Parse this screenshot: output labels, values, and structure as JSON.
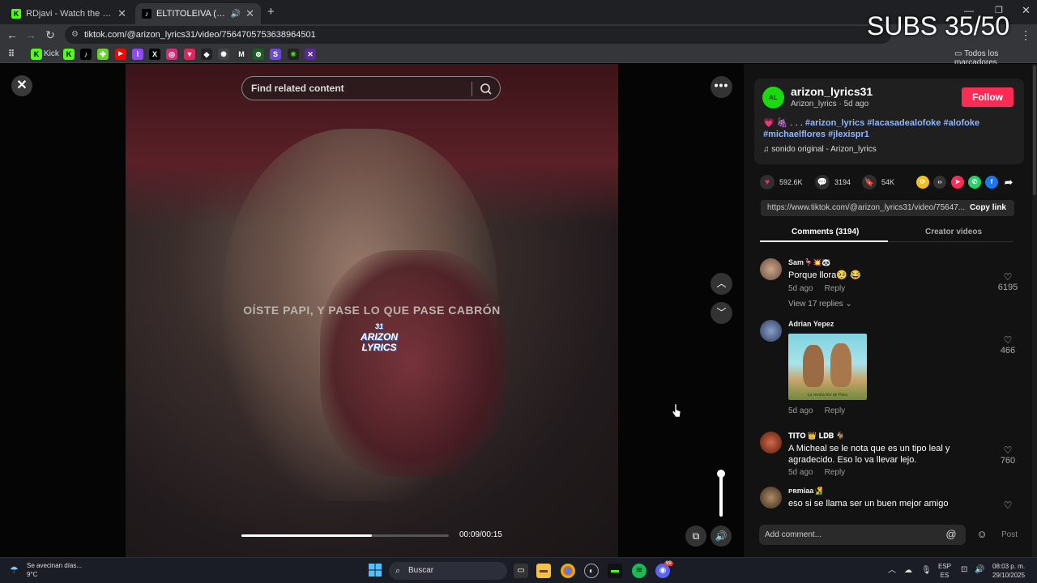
{
  "browser": {
    "tabs": [
      {
        "title": "RDjavi - Watch the VOD on Kick",
        "active": false
      },
      {
        "title": "ELTITOLEIVA (@eltitoleiva) |",
        "active": true
      }
    ],
    "new_tab": "+",
    "url": "tiktok.com/@arizon_lyrics31/video/7564705753638964501",
    "overlay_text": "SUBS 35/50",
    "bookmarks": [
      "Kick"
    ],
    "bookmarks_folder": "Todos los marcadores"
  },
  "player": {
    "search_placeholder": "Find related content",
    "caption": "OÍSTE PAPI, Y PASE LO QUE PASE CABRÓN",
    "watermark_top": "31",
    "watermark": "ARIZON LYRICS",
    "time": "00:09/00:15",
    "progress_fraction": 0.63
  },
  "post": {
    "username": "arizon_lyrics31",
    "user_line": "Arizon_lyrics · 5d ago",
    "follow_label": "Follow",
    "emoji_prefix": "💗 🍇 . . .",
    "hashtags": "#arizon_lyrics #lacasadealofoke #alofoke #michaelflores #jlexispr1",
    "sound": "sonido original - Arizon_lyrics",
    "likes": "592.6K",
    "comments_count": "3194",
    "saves": "54K",
    "link": "https://www.tiktok.com/@arizon_lyrics31/video/75647...",
    "copy_link": "Copy link"
  },
  "tabs": {
    "comments": "Comments (3194)",
    "creator": "Creator videos"
  },
  "comments": [
    {
      "name": "Sam🦩💥🐼",
      "text": "Porque llora🥺 😂",
      "time": "5d ago",
      "reply": "Reply",
      "likes": "6195",
      "view_replies": "View 17 replies"
    },
    {
      "name": "Adrian Yepez",
      "text": "",
      "time": "5d ago",
      "reply": "Reply",
      "likes": "466",
      "image_caption": "La revolución de Paco"
    },
    {
      "name": "𝐓𝐈𝐓𝐎 👑 𝐋𝐃𝐁 🐐",
      "text": "A Micheal se le nota que es un tipo leal y agradecido. Eso lo va llevar lejo.",
      "time": "5d ago",
      "reply": "Reply",
      "likes": "760"
    },
    {
      "name": "ᴘʀmiaa🧏‍♂️",
      "text": "eso si se llama ser un buen mejor amigo",
      "time": "",
      "reply": "",
      "likes": ""
    }
  ],
  "composer": {
    "placeholder": "Add comment...",
    "post_label": "Post"
  },
  "taskbar": {
    "weather_text": "Se avecinan días...",
    "temperature": "9°C",
    "search": "Buscar",
    "lang": "ESP",
    "lang_sub": "ES",
    "time": "08:03 p. m.",
    "date": "29/10/2025",
    "discord_badge": "99"
  }
}
